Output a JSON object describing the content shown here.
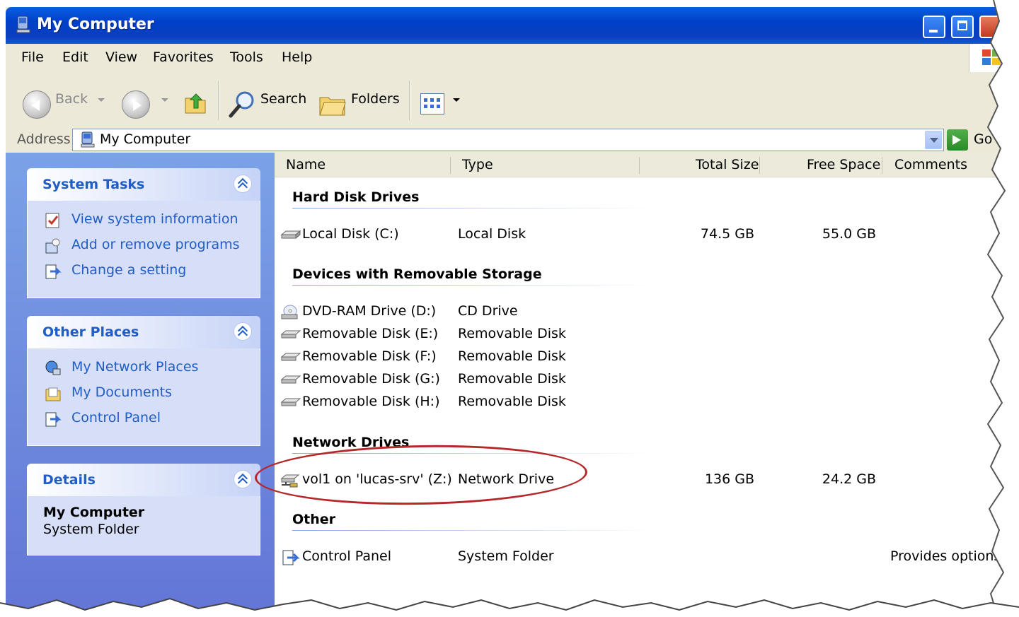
{
  "window": {
    "title": "My Computer"
  },
  "menu": {
    "items": [
      "File",
      "Edit",
      "View",
      "Favorites",
      "Tools",
      "Help"
    ]
  },
  "toolbar": {
    "back_label": "Back",
    "search_label": "Search",
    "folders_label": "Folders"
  },
  "address": {
    "label": "Address",
    "value": "My Computer",
    "go_label": "Go"
  },
  "sidebar": {
    "system_tasks": {
      "title": "System Tasks",
      "items": [
        "View system information",
        "Add or remove programs",
        "Change a setting"
      ]
    },
    "other_places": {
      "title": "Other Places",
      "items": [
        "My Network Places",
        "My Documents",
        "Control Panel"
      ]
    },
    "details": {
      "title": "Details",
      "name": "My Computer",
      "subtitle": "System Folder"
    }
  },
  "columns": {
    "name": "Name",
    "type": "Type",
    "total": "Total Size",
    "free": "Free Space",
    "comments": "Comments"
  },
  "groups": {
    "hdd": {
      "title": "Hard Disk Drives",
      "rows": [
        {
          "name": "Local Disk (C:)",
          "type": "Local Disk",
          "total": "74.5 GB",
          "free": "55.0 GB",
          "comments": ""
        }
      ]
    },
    "removable": {
      "title": "Devices with Removable Storage",
      "rows": [
        {
          "name": "DVD-RAM Drive (D:)",
          "type": "CD Drive"
        },
        {
          "name": "Removable Disk (E:)",
          "type": "Removable Disk"
        },
        {
          "name": "Removable Disk (F:)",
          "type": "Removable Disk"
        },
        {
          "name": "Removable Disk (G:)",
          "type": "Removable Disk"
        },
        {
          "name": "Removable Disk (H:)",
          "type": "Removable Disk"
        }
      ]
    },
    "network": {
      "title": "Network Drives",
      "rows": [
        {
          "name": "vol1 on 'lucas-srv' (Z:)",
          "type": "Network Drive",
          "total": "136 GB",
          "free": "24.2 GB"
        }
      ]
    },
    "other": {
      "title": "Other",
      "rows": [
        {
          "name": "Control Panel",
          "type": "System Folder",
          "comments": "Provides options f"
        }
      ]
    }
  },
  "colors": {
    "title_bar": "#0a4fd8",
    "task_link": "#215dc6",
    "highlight_ellipse": "#b4282a"
  }
}
